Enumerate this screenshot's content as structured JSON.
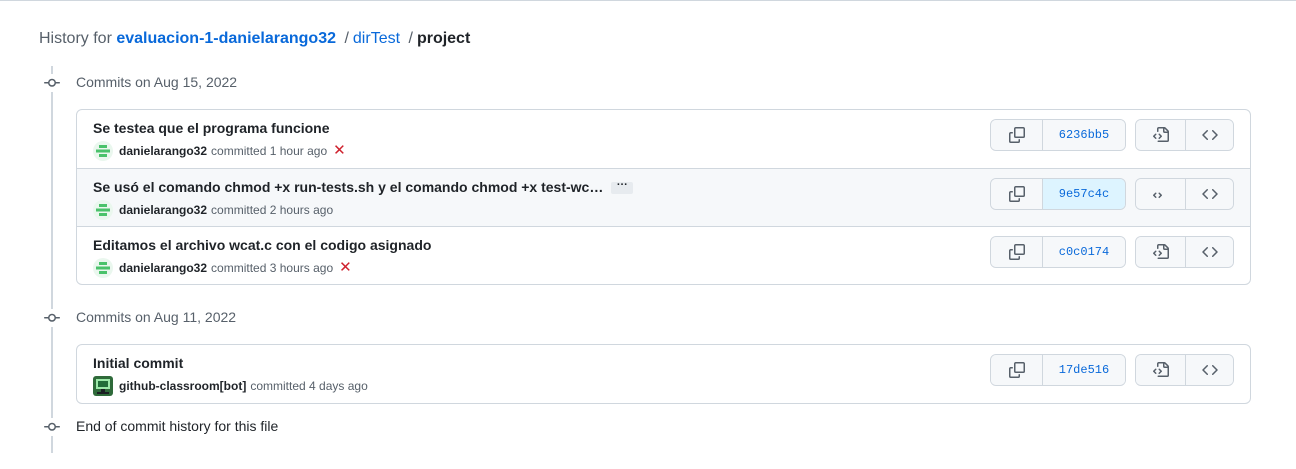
{
  "breadcrumb": {
    "prefix": "History for",
    "repo": "evaluacion-1-danielarango32",
    "separator": "/",
    "dir": "dirTest",
    "file": "project"
  },
  "groups": [
    {
      "label": "Commits on Aug 15, 2022",
      "commits": [
        {
          "message": "Se testea que el programa funcione",
          "author": "danielarango32",
          "action": "committed",
          "time": "1 hour ago",
          "status": "failure",
          "status_glyph": "✕",
          "sha": "6236bb5"
        },
        {
          "message": "Se usó el comando chmod +x run-tests.sh y el comando chmod +x test-wc…",
          "expand": "···",
          "author": "danielarango32",
          "action": "committed",
          "time": "2 hours ago",
          "status": "none",
          "sha": "9e57c4c"
        },
        {
          "message": "Editamos el archivo wcat.c con el codigo asignado",
          "author": "danielarango32",
          "action": "committed",
          "time": "3 hours ago",
          "status": "failure",
          "status_glyph": "✕",
          "sha": "c0c0174"
        }
      ]
    },
    {
      "label": "Commits on Aug 11, 2022",
      "commits": [
        {
          "message": "Initial commit",
          "author": "github-classroom[bot]",
          "action": "committed",
          "time": "4 days ago",
          "status": "none",
          "sha": "17de516"
        }
      ]
    }
  ],
  "end_label": "End of commit history for this file",
  "icons": {
    "commit_node": "git-commit-icon",
    "copy": "copy-icon",
    "browse": "file-code-icon",
    "code": "code-icon",
    "status_fail": "x-icon"
  },
  "colors": {
    "link": "#0969da",
    "fail": "#cf222e",
    "avatar_user": "#4ac26b",
    "border": "#d0d7de"
  }
}
